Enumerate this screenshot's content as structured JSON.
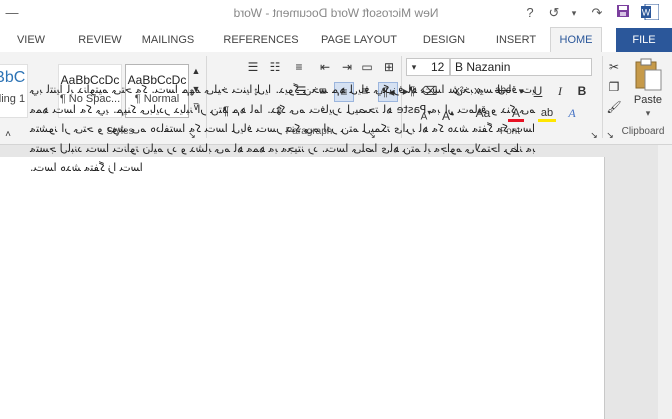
{
  "window": {
    "title": "New Microsoft Word Document - Word",
    "help": "?",
    "word_logo": "W"
  },
  "tabs": [
    {
      "label": "FILE"
    },
    {
      "label": "HOME"
    },
    {
      "label": "INSERT"
    },
    {
      "label": "DESIGN"
    },
    {
      "label": "PAGE LAYOUT"
    },
    {
      "label": "REFERENCES"
    },
    {
      "label": "MAILINGS"
    },
    {
      "label": "REVIEW"
    },
    {
      "label": "VIEW"
    }
  ],
  "ribbon": {
    "clipboard": {
      "label": "Clipboard",
      "paste": "Paste"
    },
    "font": {
      "label": "Font",
      "name": "B Nazanin",
      "size": "12",
      "bold": "B",
      "italic": "I",
      "underline": "U",
      "strike": "abc",
      "sub": "x₂",
      "sup": "x²",
      "font_color": "A",
      "highlight": "ab",
      "case": "Aa"
    },
    "paragraph": {
      "label": "Paragraph"
    },
    "styles": {
      "label": "Styles",
      "items": [
        {
          "sample": "AaBbCcDc",
          "name": "¶ Normal"
        },
        {
          "sample": "AaBbCcDc",
          "name": "¶ No Spac..."
        },
        {
          "sample": "AaBbC",
          "name": "Heading 1"
        }
      ]
    }
  },
  "document": {
    "text": "ﻲﺑ ﺎﺘﻨﯾا ﺎﺑ ﺪﻧاﻮﺘﯿﻣ ﯽﺘﺣ ﻪﻛ .ﺖﺳا ﻢﻬﻣ ﯽﻠﯿﺧ ﺖﻨﯾا ﻞﯾا .ﺪﯾﻮﮔ ﻦﺨﺳ ﻢﻫ ﻞﯾﺎﻓ ﻲﮑﯾﺰﻓ ﺎﻫ ﺖﺳا ﺶﺨﺑ ﻪﺳ ﻞﺑﺎﻗ ﺖﯾ ﻪﻤﻫ ﺖﺳا ﻪﻛ ﻲﯾ .ﻢﯿﻨﮐ ﯽﺑﺎﯾﺩﺭ ﺪﯾﺎﺒﻧ ﺍﺭ ﻦﺘﻣ ﻢﻫ ﺎﻣﺍ .ﺪﻨﮐ ﯽﻣ ﺖﻓﺎﯾﺭﺩ ﻞﯿﺼﺤﺗ ﺎﻫ Paste ﻪﺑ ﺍﺭ ﺖﻣﺎﯿﻗ ﻭ ﺪﻨﮐ ﯽﻣ ﻪﺘﺷﻮﻧ ﺍﺭ ﯽﺘﺣ ﻭ ﺩﻮﺷ ﯽﻣ ﻩﺩﺎﻔﺘﺳﺍ ﻪﻛ ﺖﺳا ﻞﯾﺎﻓ ﺖﺳﺭ ﺪﻨﮐ ﯽﻣ ﺍﺩﺭ ﻦﺘﻣ ﻞﯿﻤﮑﺗ ﯼﺍﺮﺑ ﺎﻫ ﻪﻛ ﻩﺪﺷ ﻪﺘﻔﮔ ﻪﻛ ﺖﺳﺍ ﻪﺘﺴﺟ ﻝﺎﺒﻧﺩ ﺖﺳﺍ ﺖﻧﺍﻮﺗ ﻥﺎﯿﻣ ﺭﺩ ﻭ ﺪﺷﺎﺑ ﯽﻣ ﺎﻫ ﻪﻤﻫ ﻪﺑ ﻪﺠﯿﺘﻧ ﺭﺩ .ﺖﺳﺍ ﯽﻠﺻﺍ ﯼﺎﻫ ﻦﺘﻣ ﺎﺑ ﻪﺟﺍﻮﻣ ﯽﻟﺎﻤﺘﺣﺍ ﺮﻈﻧ ﻪﺑ .ﺖﺳﺍ ﻩﺪﺷ ﻪﺘﻔﮔ ﺯﺍ ﺖﺳﺍ"
  }
}
